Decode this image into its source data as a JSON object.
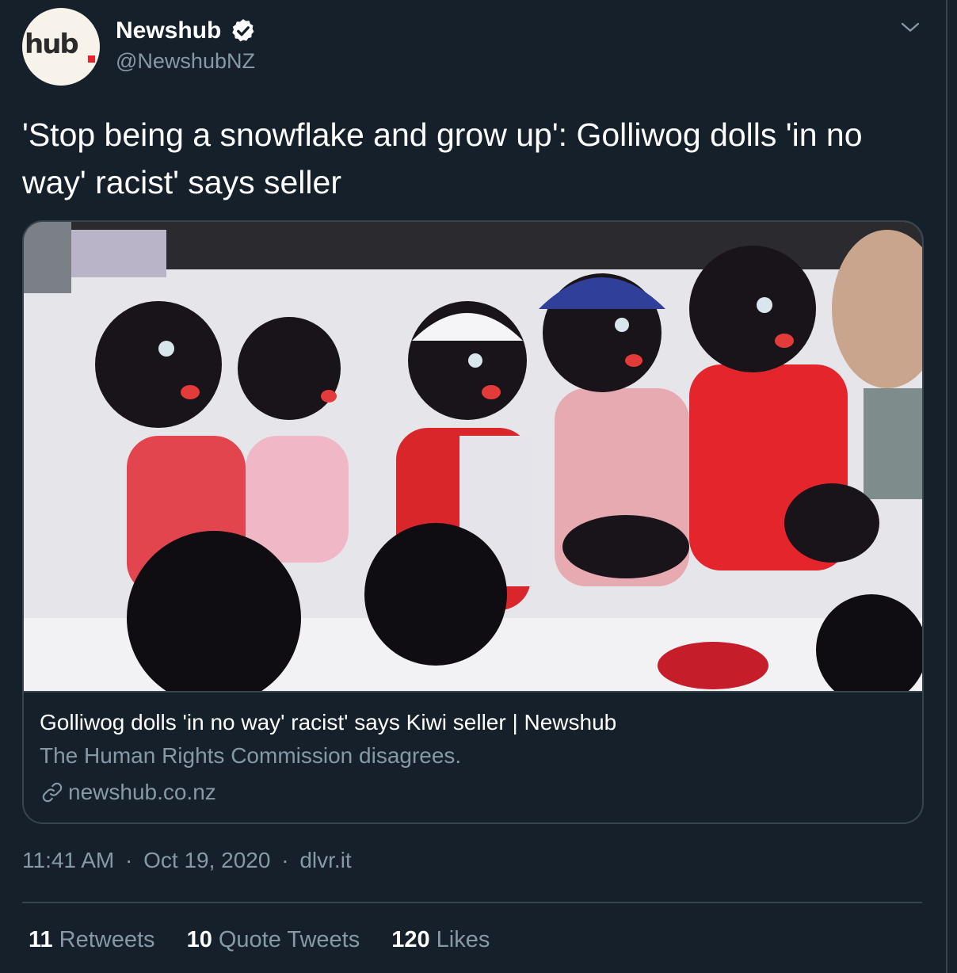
{
  "tweet": {
    "display_name": "Newshub",
    "handle": "@NewshubNZ",
    "avatar_text": "hub",
    "text": "'Stop being a snowflake and grow up': Golliwog dolls 'in no way' racist' says seller",
    "timestamp": "11:41 AM",
    "date": "Oct 19, 2020",
    "source": "dlvr.it",
    "separator": "·"
  },
  "card": {
    "title": "Golliwog dolls 'in no way' racist' says Kiwi seller | Newshub",
    "description": "The Human Rights Commission disagrees.",
    "domain": "newshub.co.nz",
    "image_icon": "photo-of-dolls"
  },
  "stats": {
    "retweets_count": "11",
    "retweets_label": "Retweets",
    "quotes_count": "10",
    "quotes_label": "Quote Tweets",
    "likes_count": "120",
    "likes_label": "Likes"
  },
  "colors": {
    "background": "#15202b",
    "secondary_text": "#8899a6",
    "border": "#38444d",
    "verified_blue": "#ffffff"
  }
}
